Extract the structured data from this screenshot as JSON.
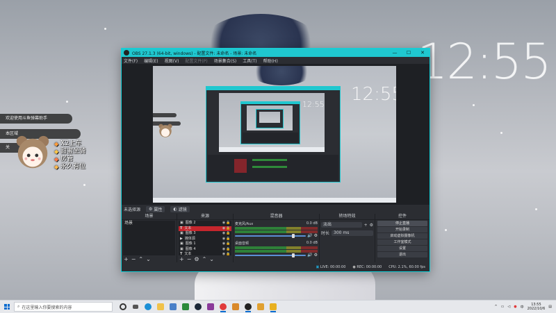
{
  "desktop": {
    "clock": "12:55",
    "nested_clock": "12:55",
    "chat_lines": [
      "欢迎使用斗鱼弹幕助手",
      "本区域",
      "关"
    ],
    "legend": [
      "X2上车",
      "甜蜜坐骑",
      "房管",
      "永久有位"
    ]
  },
  "obs": {
    "title": "OBS 27.1.3 (64-bit, windows) - 配置文件: 未命名 - 场景: 未命名",
    "menu": [
      "文件(F)",
      "编辑(E)",
      "视图(V)",
      "配置文件(P)",
      "场景集合(S)",
      "工具(T)",
      "帮助(H)"
    ],
    "scene_bar_label": "未选择源",
    "scene_bar_buttons": [
      "属性",
      "滤镜"
    ],
    "docks": {
      "scenes_title": "场景",
      "sources_title": "来源",
      "mixer_title": "混音器",
      "transitions_title": "转场特效",
      "controls_title": "控件"
    },
    "scenes": [
      "场景"
    ],
    "sources": [
      "图像 2",
      "文本",
      "图像 3",
      "媒体源",
      "图像 1",
      "图像 4",
      "文本"
    ],
    "mixer": [
      {
        "name": "麦克风/Aux",
        "db": "0.0 dB",
        "level": 0.62
      },
      {
        "name": "桌面音频",
        "db": "0.0 dB",
        "level": 0.55
      }
    ],
    "transitions": {
      "type": "淡出",
      "duration_label": "时长",
      "duration": "300 ms"
    },
    "controls": [
      "停止直播",
      "开始录制",
      "启动虚拟摄像机",
      "工作室模式",
      "设置",
      "退出"
    ],
    "status": {
      "live": "LIVE: 00:00:00",
      "rec": "REC: 00:00:00",
      "cpu": "CPU: 2.1%, 60.00 fps"
    }
  },
  "taskbar": {
    "search_placeholder": "在这里输入你要搜索的内容",
    "time": "13:55",
    "date": "2022/10/6"
  },
  "colors": {
    "accent": "#1fc7cf",
    "selected": "#c5262d",
    "taskbar": "#e6e8ec"
  }
}
